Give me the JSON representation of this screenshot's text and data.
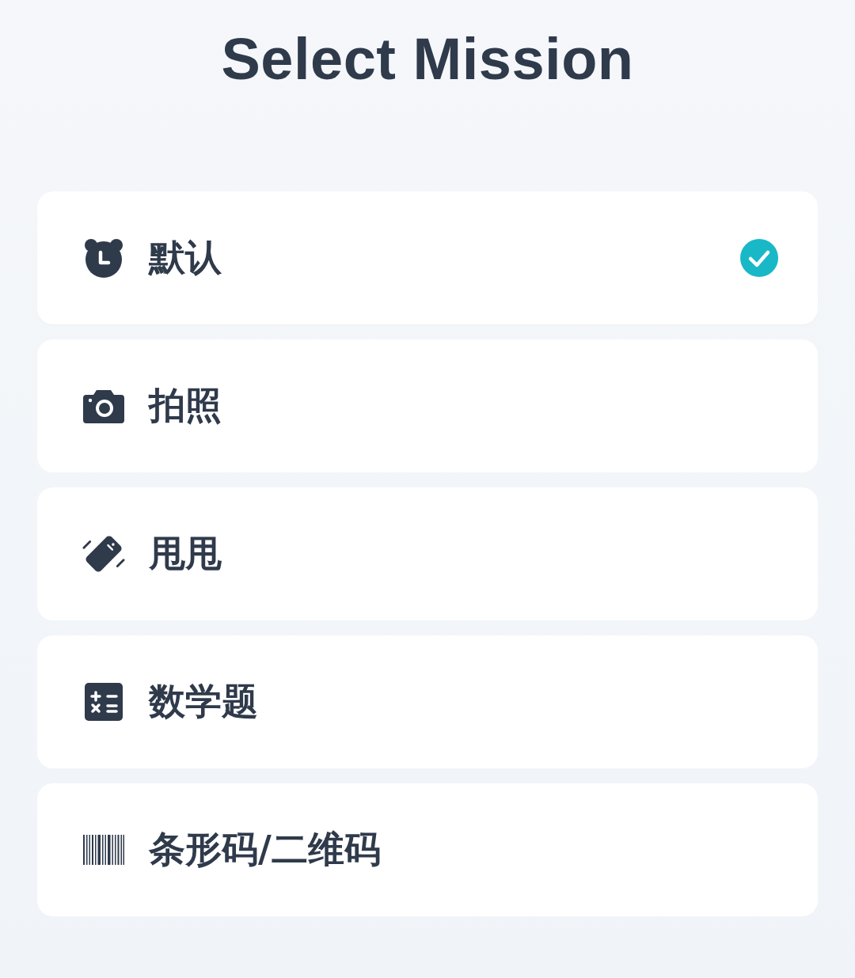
{
  "title": "Select Mission",
  "missions": [
    {
      "kind": "default",
      "label": "默认",
      "selected": true
    },
    {
      "kind": "photo",
      "label": "拍照",
      "selected": false
    },
    {
      "kind": "shake",
      "label": "甩甩",
      "selected": false
    },
    {
      "kind": "math",
      "label": "数学题",
      "selected": false
    },
    {
      "kind": "barcode",
      "label": "条形码/二维码",
      "selected": false
    }
  ]
}
